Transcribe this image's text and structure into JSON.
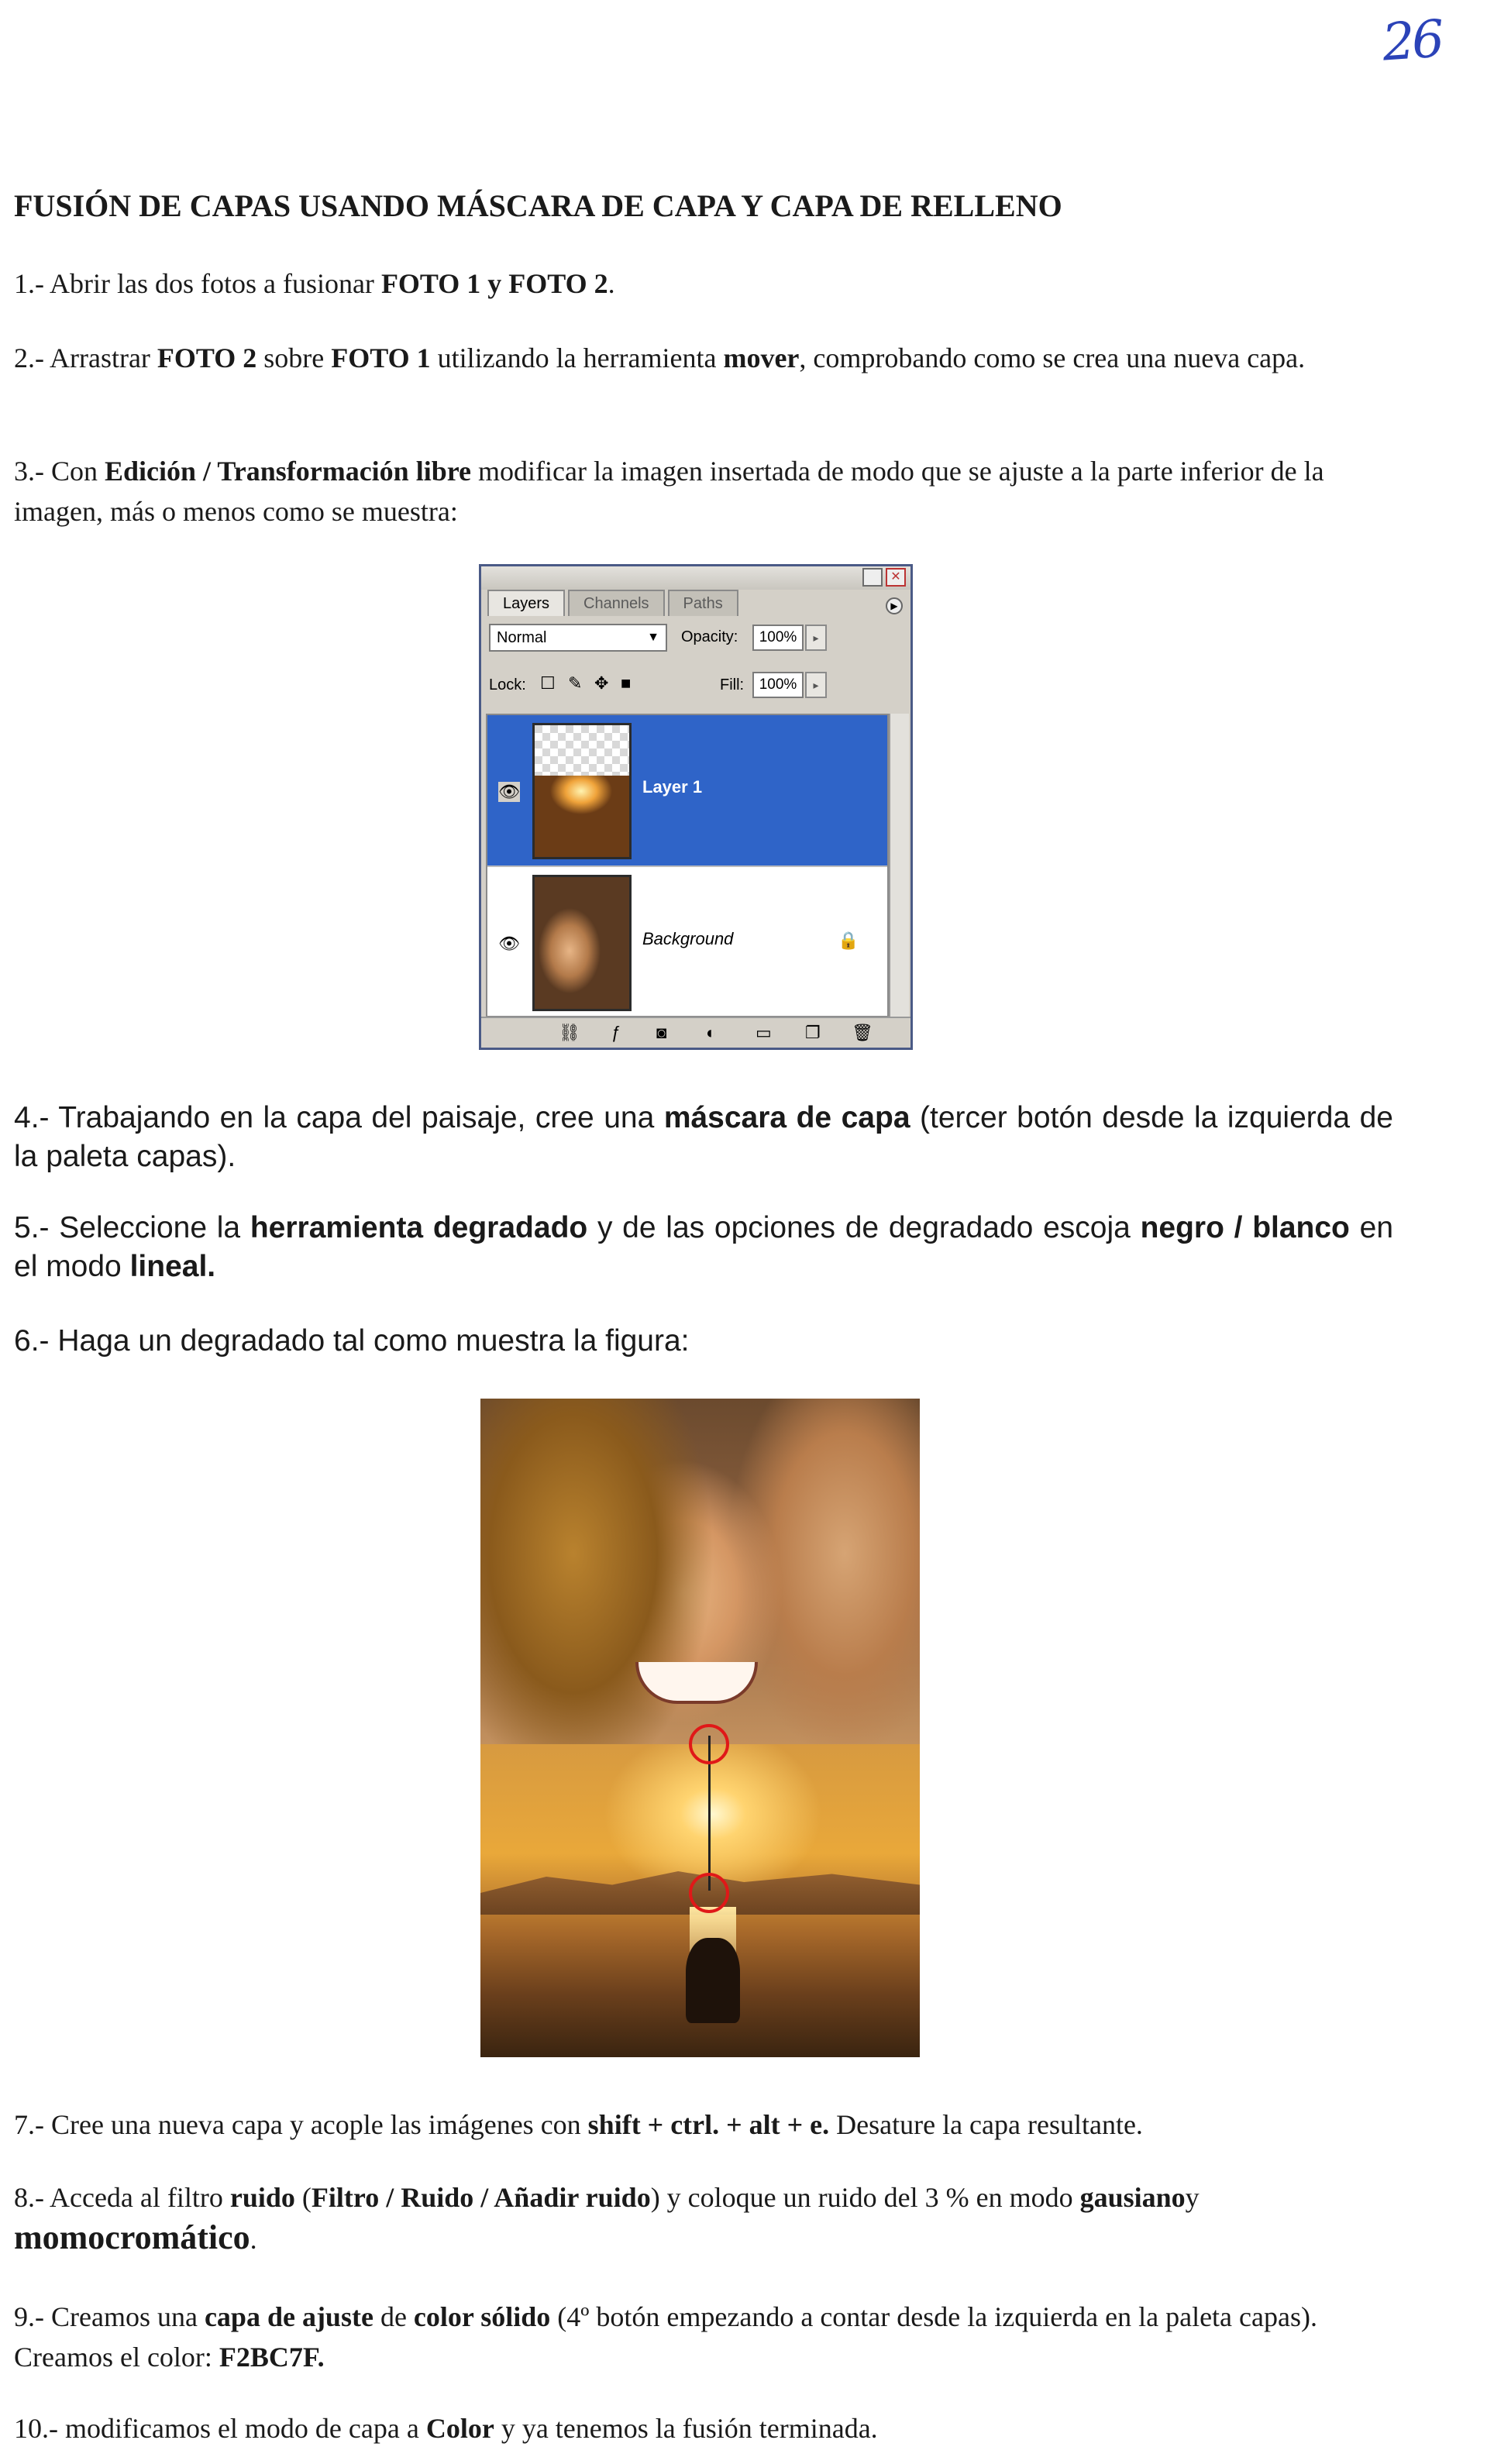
{
  "page": {
    "number": "26"
  },
  "title": "FUSIÓN DE CAPAS USANDO MÁSCARA DE CAPA Y CAPA DE RELLENO",
  "steps": {
    "s1": {
      "a": "1.- Abrir las dos fotos a fusionar ",
      "b": "FOTO 1 y FOTO 2",
      "c": "."
    },
    "s2": {
      "a": "2.- Arrastrar ",
      "b": "FOTO 2",
      "c": " sobre ",
      "d": "FOTO 1",
      "e": " utilizando la herramienta ",
      "f": "mover",
      "g": ", comprobando como se crea una nueva capa."
    },
    "s3": {
      "a": "3.- Con ",
      "b": "Edición / Transformación libre",
      "c": " modificar la imagen insertada de modo que se ajuste a la parte inferior de la imagen, más o menos como se muestra:"
    },
    "s4": {
      "a": "4.- Trabajando en la capa del paisaje, cree una ",
      "b": "máscara de capa",
      "c": " (tercer botón desde la izquierda de la paleta capas)."
    },
    "s5": {
      "a": "5.- Seleccione la ",
      "b": "herramienta degradado",
      "c": " y de las opciones de degradado escoja ",
      "d": "negro / blanco",
      "e": " en el modo ",
      "f": "lineal."
    },
    "s6": {
      "a": "6.- Haga un degradado tal como muestra la figura:"
    },
    "s7": {
      "a": "7.- Cree una nueva capa y acople las imágenes con ",
      "b": "shift + ctrl. + alt + e.",
      "c": " Desature la capa resultante."
    },
    "s8": {
      "a": "8.- Acceda al filtro ",
      "b": "ruido",
      "c": " (",
      "d": "Filtro / Ruido / Añadir ruido",
      "e": ") y coloque un ruido del 3 % en modo ",
      "f": "gausiano",
      "g": "y ",
      "h": "momocromático",
      "i": "."
    },
    "s9": {
      "a": "9.- Creamos una ",
      "b": "capa de ajuste",
      "c": "  de ",
      "d": "color sólido",
      "e": " (4º botón empezando a contar desde la izquierda en la paleta capas). Creamos el color: ",
      "f": "F2BC7F."
    },
    "s10": {
      "a": "10.- modificamos el modo de capa a ",
      "b": "Color",
      "c": "  y ya tenemos la fusión terminada."
    }
  },
  "layers_panel": {
    "tabs": [
      "Layers",
      "Channels",
      "Paths"
    ],
    "blend_mode": "Normal",
    "opacity_label": "Opacity:",
    "opacity_value": "100%",
    "lock_label": "Lock:",
    "fill_label": "Fill:",
    "fill_value": "100%",
    "layers": [
      {
        "name": "Layer 1",
        "selected": true
      },
      {
        "name": "Background",
        "selected": false
      }
    ],
    "icons": [
      "link-icon",
      "fx-icon",
      "layer-mask-icon",
      "adjustment-layer-icon",
      "group-folder-icon",
      "new-layer-icon",
      "trash-icon"
    ]
  },
  "colors": {
    "selection": "#2f64c8",
    "page_number": "#2b43b8",
    "gradient_marker": "#e01818"
  }
}
